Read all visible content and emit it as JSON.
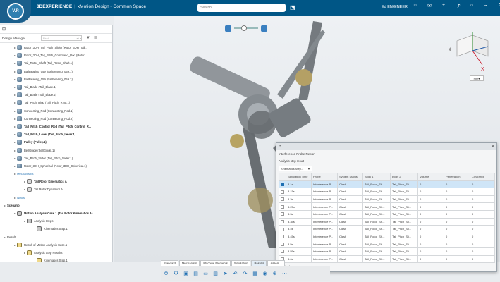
{
  "header": {
    "compass_label": "V.R",
    "brand": "3DEXPERIENCE",
    "separator": "|",
    "app": "xMotion Design - Common Space",
    "search_placeholder": "Search",
    "user": "Ed ENGINEER",
    "icons": [
      "user-icon",
      "chat-icon",
      "add-icon",
      "share-icon",
      "home-icon",
      "broadcast-icon",
      "help-icon"
    ]
  },
  "design_manager": {
    "title": "Design Manager",
    "filter_placeholder": "Find",
    "tree": [
      {
        "label": "Rotor_3DH_Tail_Pitch_Slider (Rotor_3DH_Tail...",
        "type": "part",
        "indent": 1
      },
      {
        "label": "Rotor_3DH_Tail_Pitch_Command_Rod (Rotor...",
        "type": "part",
        "indent": 1
      },
      {
        "label": "Tail_Rotor_Shaft (Tail_Rotor_Shaft.1)",
        "type": "part",
        "indent": 1
      },
      {
        "label": "BallBearing_059 (BallBearing_059.1)",
        "type": "part",
        "indent": 1
      },
      {
        "label": "BallBearing_059 (BallBearing_059.2)",
        "type": "part",
        "indent": 1
      },
      {
        "label": "Tail_Blade (Tail_Blade.1)",
        "type": "part",
        "indent": 1
      },
      {
        "label": "Tail_Blade (Tail_Blade.2)",
        "type": "part",
        "indent": 1
      },
      {
        "label": "Tail_Pitch_Ring (Tail_Pitch_Ring.1)",
        "type": "part",
        "indent": 1
      },
      {
        "label": "Connecting_Rod (Connecting_Rod.1)",
        "type": "part",
        "indent": 1
      },
      {
        "label": "Connecting_Rod (Connecting_Rod.2)",
        "type": "part",
        "indent": 1
      },
      {
        "label": "Tail_Pitch_Control_Rod (Tail_Pitch_Control_R...",
        "type": "part",
        "indent": 1,
        "bold": true
      },
      {
        "label": "Tail_Pitch_Lever (Tail_Pitch_Lever.1)",
        "type": "part",
        "indent": 1,
        "bold": true
      },
      {
        "label": "Pulley (Pulley.1)",
        "type": "part",
        "indent": 1,
        "bold": true
      },
      {
        "label": "BellGuide (BellGuide.1)",
        "type": "part",
        "indent": 1
      },
      {
        "label": "Tail_Pitch_Slider (Tail_Pitch_Slider.1)",
        "type": "part",
        "indent": 1
      },
      {
        "label": "Rotor_3DH_Spherical (Rotor_3DH_Spherical.1)",
        "type": "part",
        "indent": 1
      },
      {
        "label": "Mechanisms",
        "type": "none",
        "indent": 1,
        "blue": true
      },
      {
        "label": "Tail Rotor Kinematics A",
        "type": "mech",
        "indent": 2,
        "bold": true
      },
      {
        "label": "Tail Rotor Dynamics A",
        "type": "mech",
        "indent": 2
      },
      {
        "label": "Notes",
        "type": "none",
        "indent": 1,
        "blue": true
      },
      {
        "label": "Scenario",
        "type": "none",
        "indent": 0,
        "bold": true
      },
      {
        "label": "Motion Analysis Case.1 (Tail Rotor Kinematics A)",
        "type": "scen",
        "indent": 1,
        "bold": true
      },
      {
        "label": "Analysis Steps",
        "type": "scen",
        "indent": 2
      },
      {
        "label": "Kinematics Step.1",
        "type": "scen",
        "indent": 3
      },
      {
        "label": "Result",
        "type": "none",
        "indent": 0
      },
      {
        "label": "Result of Motion Analysis Case.1",
        "type": "result",
        "indent": 1
      },
      {
        "label": "Analysis Step Results",
        "type": "result",
        "indent": 2
      },
      {
        "label": "Kinematics Step.1",
        "type": "result",
        "indent": 3
      }
    ]
  },
  "viewport": {
    "nav_unit": "mm"
  },
  "report": {
    "title": "Interference Probe Report",
    "subtitle": "Analysis step result",
    "step_select": "Kinematics Step.1",
    "columns": [
      "",
      "Simulation Time",
      "Probe",
      "System Status",
      "Body 1",
      "Body 2",
      "Volume",
      "Penetration",
      "Clearance"
    ],
    "rows": [
      [
        "1",
        "3.1s",
        "Interference P...",
        "Clash",
        "Tail_Rotor_Sh...",
        "Tail_Pitch_Sli...",
        "0",
        "0",
        "0"
      ],
      [
        "2",
        "3.15s",
        "Interference P...",
        "Clash",
        "Tail_Rotor_Sh...",
        "Tail_Pitch_Sli...",
        "0",
        "0",
        "0"
      ],
      [
        "3",
        "3.2s",
        "Interference P...",
        "Clash",
        "Tail_Rotor_Sh...",
        "Tail_Pitch_Sli...",
        "0",
        "0",
        "0"
      ],
      [
        "4",
        "3.25s",
        "Interference P...",
        "Clash",
        "Tail_Rotor_Sh...",
        "Tail_Pitch_Sli...",
        "0",
        "0",
        "0"
      ],
      [
        "5",
        "3.3s",
        "Interference P...",
        "Clash",
        "Tail_Rotor_Sh...",
        "Tail_Pitch_Sli...",
        "0",
        "0",
        "0"
      ],
      [
        "6",
        "3.35s",
        "Interference P...",
        "Clash",
        "Tail_Rotor_Sh...",
        "Tail_Pitch_Sli...",
        "0",
        "0",
        "0"
      ],
      [
        "7",
        "3.4s",
        "Interference P...",
        "Clash",
        "Tail_Rotor_Sh...",
        "Tail_Pitch_Sli...",
        "0",
        "0",
        "0"
      ],
      [
        "8",
        "3.45s",
        "Interference P...",
        "Clash",
        "Tail_Rotor_Sh...",
        "Tail_Pitch_Sli...",
        "0",
        "0",
        "0"
      ],
      [
        "9",
        "3.5s",
        "Interference P...",
        "Clash",
        "Tail_Rotor_Sh...",
        "Tail_Pitch_Sli...",
        "0",
        "0",
        "0"
      ],
      [
        "10",
        "3.55s",
        "Interference P...",
        "Clash",
        "Tail_Rotor_Sh...",
        "Tail_Pitch_Sli...",
        "0",
        "0",
        "0"
      ],
      [
        "11",
        "3.6s",
        "Interference P...",
        "Clash",
        "Tail_Rotor_Sh...",
        "Tail_Pitch_Sli...",
        "0",
        "0",
        "0"
      ]
    ],
    "footer": "27 Clashes"
  },
  "tabs": [
    "Standard",
    "Mechanism",
    "Machine Elements",
    "Simulation",
    "Results",
    "Assem..."
  ],
  "toolbar_icons": [
    "gear-icon",
    "drive-icon",
    "save-icon",
    "clipboard-icon",
    "folder-icon",
    "paste-icon",
    "cursor-icon",
    "undo-icon",
    "redo-icon",
    "grid-icon",
    "camera-icon",
    "probe-icon",
    "more-icon"
  ],
  "colors": {
    "topbar": "#005686",
    "accent": "#1f6fb2"
  }
}
